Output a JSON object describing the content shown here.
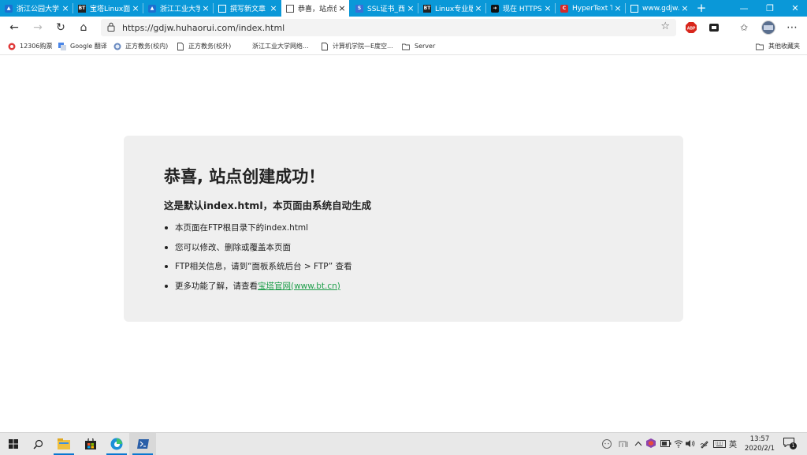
{
  "tabs": [
    {
      "title": "浙江公园大学",
      "icon": "cap-icon",
      "active": false
    },
    {
      "title": "宝塔Linux面板",
      "icon": "bt-icon",
      "active": false
    },
    {
      "title": "浙江工业大学",
      "icon": "cap-icon",
      "active": false
    },
    {
      "title": "撰写新文章",
      "icon": "doc-icon",
      "active": false
    },
    {
      "title": "恭喜，站点创建成功",
      "icon": "doc-icon",
      "active": true
    },
    {
      "title": "SSL证书_西部",
      "icon": "ssl-icon",
      "active": false
    },
    {
      "title": "Linux专业版",
      "icon": "bt-icon",
      "active": false
    },
    {
      "title": "现在 HTTPS",
      "icon": "arrow-icon",
      "active": false
    },
    {
      "title": "HyperText Tr",
      "icon": "c-icon",
      "active": false
    },
    {
      "title": "www.gdjw.hu",
      "icon": "doc-icon",
      "active": false
    }
  ],
  "address": {
    "url": "https://gdjw.huhaorui.com/index.html"
  },
  "bookmarks": [
    {
      "label": "12306购票"
    },
    {
      "label": "Google 翻译"
    },
    {
      "label": "正方教务(校内)"
    },
    {
      "label": "正方教务(校外)"
    },
    {
      "label": "浙江工业大学网络..."
    },
    {
      "label": "计算机学院—E度空..."
    },
    {
      "label": "Server"
    }
  ],
  "bookmarks_other": "其他收藏夹",
  "page": {
    "heading": "恭喜, 站点创建成功！",
    "subheading": "这是默认index.html，本页面由系统自动生成",
    "items": [
      "本页面在FTP根目录下的index.html",
      "您可以修改、删除或覆盖本页面",
      "FTP相关信息，请到“面板系统后台 > FTP” 查看"
    ],
    "last_item_prefix": "更多功能了解，请查看",
    "link_text": "宝塔官网(www.bt.cn)",
    "link_color": "#1e9e4a"
  },
  "taskbar": {
    "time": "13:57",
    "date": "2020/2/1",
    "ime": "英",
    "notification_count": "1"
  },
  "colors": {
    "tabbar": "#0a98d8",
    "card": "#efefef"
  }
}
